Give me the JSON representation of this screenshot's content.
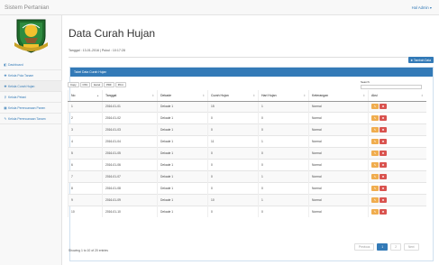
{
  "brand": "Sistem Pertanian",
  "user": "Hal Admin",
  "user_caret": "▾",
  "sidebar": {
    "items": [
      {
        "icon": "◧",
        "label": "Dashboard"
      },
      {
        "icon": "✚",
        "label": "Kelola Pola Tanam"
      },
      {
        "icon": "✚",
        "label": "Kelola Curah Hujan"
      },
      {
        "icon": "⚲",
        "label": "Kelola Petani"
      },
      {
        "icon": "▦",
        "label": "Kelola Perencanaan Panen"
      },
      {
        "icon": "✎",
        "label": "Kelola Perencanaan Tanam"
      }
    ]
  },
  "main": {
    "title": "Data Curah Hujan",
    "date_line": "Tanggal : 13-01-2016 | Pukul : 10:17:28",
    "add_button": "✚ Tambah Data",
    "panel_title": "Tabel Data Curah Hujan",
    "export_buttons": [
      "Copy",
      "CSV",
      "Excel",
      "PDF",
      "Print"
    ],
    "search_label": "Search:",
    "search_value": "",
    "columns": [
      "No",
      "Tanggal",
      "Dekade",
      "Curah Hujan",
      "Hari Hujan",
      "Keterangan",
      "Aksi"
    ],
    "sort_asc": "▲",
    "sort_both": "⇕",
    "edit_glyph": "✎",
    "delete_glyph": "✖",
    "rows": [
      {
        "no": "1",
        "tanggal": "2016-01-01",
        "dekade": "Dekade 1",
        "curah": "15",
        "hari": "1",
        "ket": "Normal"
      },
      {
        "no": "2",
        "tanggal": "2016-01-02",
        "dekade": "Dekade 1",
        "curah": "0",
        "hari": "0",
        "ket": "Normal"
      },
      {
        "no": "3",
        "tanggal": "2016-01-03",
        "dekade": "Dekade 1",
        "curah": "0",
        "hari": "0",
        "ket": "Normal"
      },
      {
        "no": "4",
        "tanggal": "2016-01-04",
        "dekade": "Dekade 1",
        "curah": "11",
        "hari": "1",
        "ket": "Normal"
      },
      {
        "no": "5",
        "tanggal": "2016-01-05",
        "dekade": "Dekade 1",
        "curah": "0",
        "hari": "0",
        "ket": "Normal"
      },
      {
        "no": "6",
        "tanggal": "2016-01-06",
        "dekade": "Dekade 1",
        "curah": "0",
        "hari": "0",
        "ket": "Normal"
      },
      {
        "no": "7",
        "tanggal": "2016-01-07",
        "dekade": "Dekade 1",
        "curah": "0",
        "hari": "1",
        "ket": "Normal"
      },
      {
        "no": "8",
        "tanggal": "2016-01-08",
        "dekade": "Dekade 1",
        "curah": "0",
        "hari": "0",
        "ket": "Normal"
      },
      {
        "no": "9",
        "tanggal": "2016-01-09",
        "dekade": "Dekade 1",
        "curah": "10",
        "hari": "1",
        "ket": "Normal"
      },
      {
        "no": "10",
        "tanggal": "2016-01-10",
        "dekade": "Dekade 1",
        "curah": "0",
        "hari": "0",
        "ket": "Normal"
      }
    ],
    "info": "Showing 1 to 10 of 20 entries",
    "pagination": {
      "prev": "Previous",
      "pages": [
        "1",
        "2"
      ],
      "next": "Next"
    }
  },
  "colors": {
    "primary": "#337ab7",
    "edit": "#f0ad4e",
    "delete": "#d9534f"
  }
}
